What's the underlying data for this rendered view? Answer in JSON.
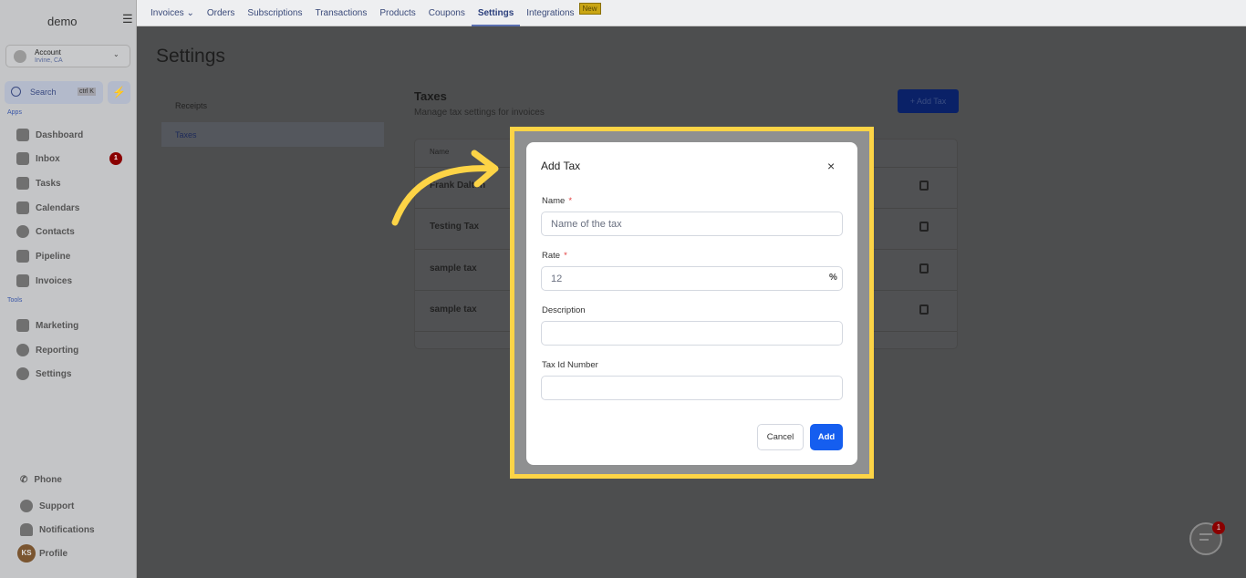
{
  "brand": "demo",
  "account": {
    "name": "Account",
    "location": "Irvine, CA"
  },
  "search": {
    "label": "Search",
    "shortcut": "ctrl K"
  },
  "sidebar": {
    "apps_label": "Apps",
    "tools_label": "Tools",
    "apps": [
      {
        "label": "Dashboard"
      },
      {
        "label": "Inbox",
        "badge": "1"
      },
      {
        "label": "Tasks"
      },
      {
        "label": "Calendars"
      },
      {
        "label": "Contacts"
      },
      {
        "label": "Pipeline"
      },
      {
        "label": "Invoices"
      }
    ],
    "tools": [
      {
        "label": "Marketing"
      },
      {
        "label": "Reporting"
      },
      {
        "label": "Settings"
      }
    ],
    "bottom": [
      {
        "label": "Phone"
      },
      {
        "label": "Support"
      },
      {
        "label": "Notifications"
      },
      {
        "label": "Profile",
        "initials": "KS"
      }
    ]
  },
  "topnav": {
    "items": [
      "Invoices",
      "Orders",
      "Subscriptions",
      "Transactions",
      "Products",
      "Coupons",
      "Settings",
      "Integrations"
    ],
    "active": "Settings",
    "new_badge": "New"
  },
  "page": {
    "title": "Settings",
    "subnav": [
      "Receipts",
      "Taxes"
    ],
    "active_subnav": "Taxes"
  },
  "taxes": {
    "title": "Taxes",
    "subtitle": "Manage tax settings for invoices",
    "add_button": "+ Add Tax",
    "col_name": "Name",
    "rows": [
      "Frank Dalton",
      "Testing Tax",
      "sample tax",
      "sample tax"
    ]
  },
  "modal": {
    "title": "Add Tax",
    "name_label": "Name",
    "name_placeholder": "Name of the tax",
    "rate_label": "Rate",
    "rate_placeholder": "12",
    "rate_suffix": "%",
    "description_label": "Description",
    "taxid_label": "Tax Id Number",
    "required_mark": "*",
    "cancel": "Cancel",
    "add": "Add"
  },
  "chat": {
    "badge": "1"
  },
  "colors": {
    "highlight": "#fdd446",
    "primary": "#155eef",
    "badge": "#b00000"
  }
}
